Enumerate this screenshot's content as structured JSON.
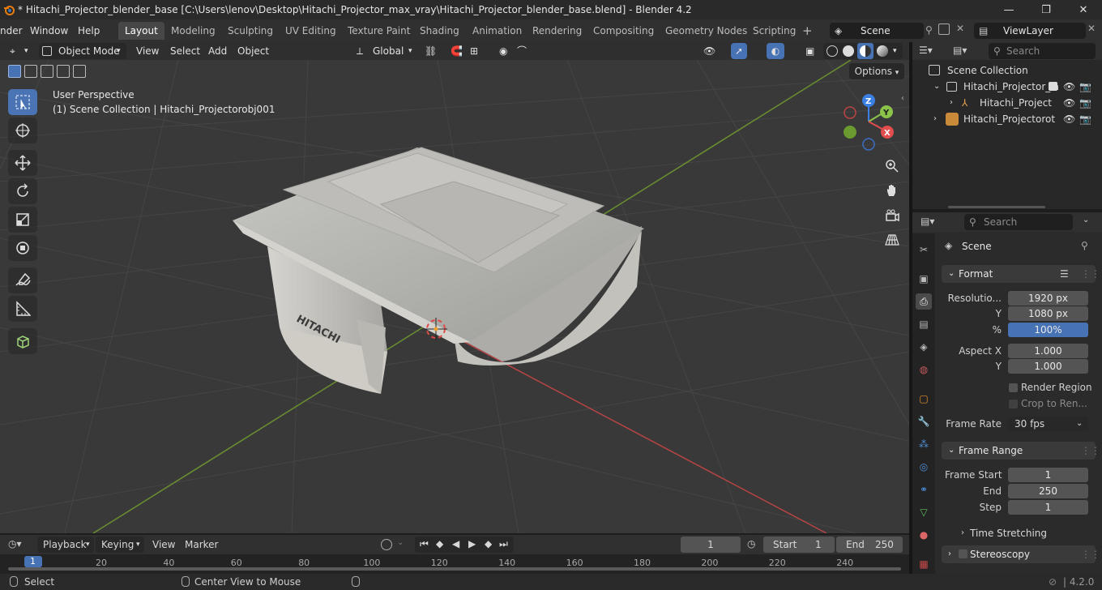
{
  "window": {
    "title": "* Hitachi_Projector_blender_base [C:\\Users\\lenov\\Desktop\\Hitachi_Projector_max_vray\\Hitachi_Projector_blender_base.blend] - Blender 4.2",
    "minimize": "—",
    "maximize": "❐",
    "close": "✕"
  },
  "menu": [
    "nder",
    "Window",
    "Help"
  ],
  "workspaces": [
    "Layout",
    "Modeling",
    "Sculpting",
    "UV Editing",
    "Texture Paint",
    "Shading",
    "Animation",
    "Rendering",
    "Compositing",
    "Geometry Nodes",
    "Scripting"
  ],
  "scene_name": "Scene",
  "view_layer": "ViewLayer",
  "viewport_header": {
    "mode": "Object Mode",
    "menus": [
      "View",
      "Select",
      "Add",
      "Object"
    ],
    "orientation": "Global",
    "options": "Options"
  },
  "viewport": {
    "perspective": "User Perspective",
    "collection_info": "(1) Scene Collection | Hitachi_Projectorobj001",
    "logo_text": "HITACHI",
    "gizmo": {
      "z": "Z",
      "y": "Y",
      "x": "X"
    }
  },
  "outliner": {
    "search_placeholder": "Search",
    "rows": [
      {
        "label": "Scene Collection"
      },
      {
        "label": "Hitachi_Projector_la"
      },
      {
        "label": "Hitachi_Project"
      },
      {
        "label": "Hitachi_Projectorot"
      }
    ]
  },
  "properties": {
    "search_placeholder": "Search",
    "context": "Scene",
    "format_panel": "Format",
    "resolution_label": "Resolutio...",
    "resolution_x": "1920 px",
    "y_label": "Y",
    "resolution_y": "1080 px",
    "percent_label": "%",
    "percent": "100%",
    "percent_fraction": 1.0,
    "aspect_label": "Aspect X",
    "aspect_x": "1.000",
    "aspect_y": "1.000",
    "render_region": "Render Region",
    "crop_to_render": "Crop to Ren...",
    "frame_rate_label": "Frame Rate",
    "frame_rate": "30 fps",
    "frame_range_panel": "Frame Range",
    "frame_start_label": "Frame Start",
    "frame_start": "1",
    "end_label": "End",
    "frame_end": "250",
    "step_label": "Step",
    "frame_step": "1",
    "time_stretching": "Time Stretching",
    "stereoscopy": "Stereoscopy"
  },
  "timeline": {
    "menus": [
      "Playback",
      "Keying",
      "View",
      "Marker"
    ],
    "current_frame": "1",
    "start_label": "Start",
    "start": "1",
    "end_label": "End",
    "end": "250",
    "ticks": [
      "1",
      "20",
      "40",
      "60",
      "80",
      "100",
      "120",
      "140",
      "160",
      "180",
      "200",
      "220",
      "240"
    ]
  },
  "status": {
    "select": "Select",
    "center_view": "Center View to Mouse",
    "version": "4.2.0"
  },
  "colors": {
    "accent": "#4772b3",
    "x_axis": "#e24d4d",
    "y_axis": "#8bc34a",
    "z_axis": "#3b7fe3"
  }
}
